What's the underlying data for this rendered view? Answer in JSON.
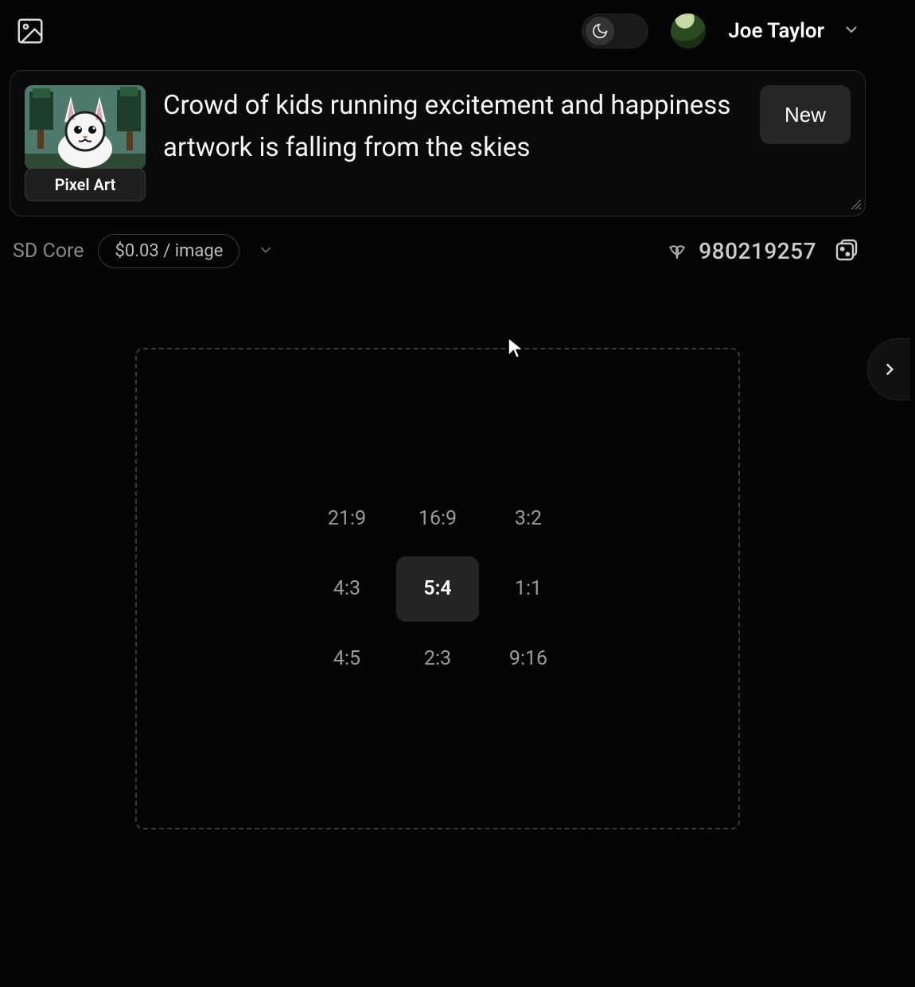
{
  "header": {
    "username": "Joe Taylor"
  },
  "prompt": {
    "text": "Crowd of kids running excitement and happiness artwork is falling from the skies",
    "style_label": "Pixel Art",
    "new_button": "New"
  },
  "settings": {
    "model": "SD Core",
    "price": "$0.03 / image",
    "seed": "980219257"
  },
  "aspect_ratios": {
    "options": [
      "21:9",
      "16:9",
      "3:2",
      "4:3",
      "5:4",
      "1:1",
      "4:5",
      "2:3",
      "9:16"
    ],
    "selected": "5:4"
  }
}
